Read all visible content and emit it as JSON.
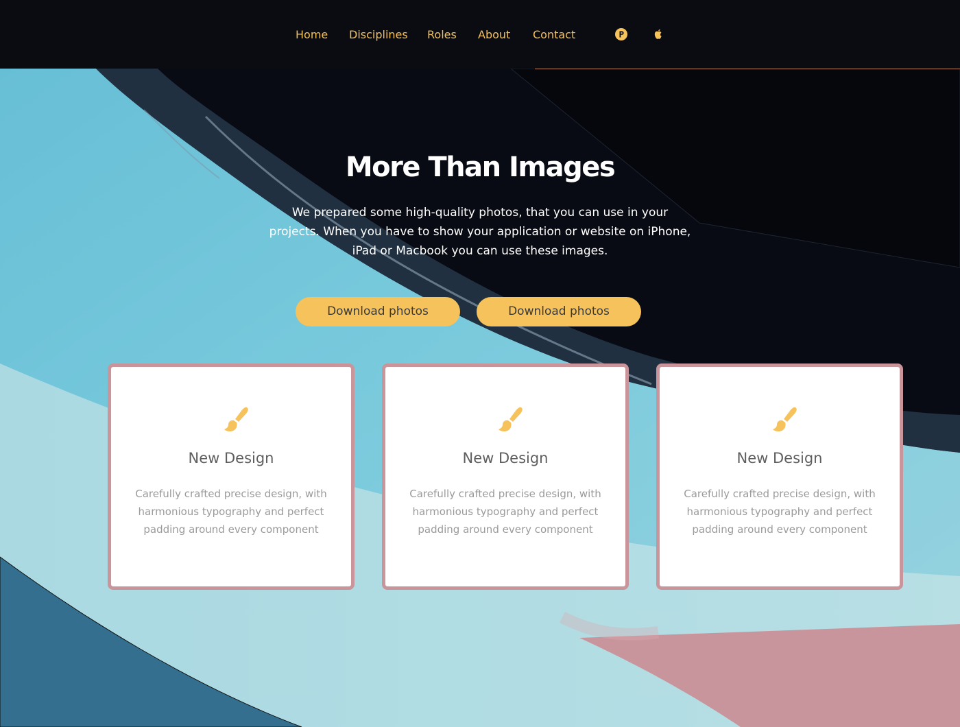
{
  "nav": {
    "links": [
      "Home",
      "Disciplines",
      "Roles",
      "About",
      "Contact"
    ],
    "icons": [
      "producthunt-icon",
      "apple-icon"
    ]
  },
  "hero": {
    "title": "More Than Images",
    "description": "We prepared some high-quality photos, that you can use in your projects. When you have to show your application or website on iPhone, iPad or Macbook you can use these images.",
    "buttons": [
      "Download photos",
      "Download photos"
    ]
  },
  "cards": [
    {
      "icon": "paint-brush-icon",
      "title": "New Design",
      "text": "Carefully crafted precise design, with harmonious typography and perfect padding around every component"
    },
    {
      "icon": "paint-brush-icon",
      "title": "New Design",
      "text": "Carefully crafted precise design, with harmonious typography and perfect padding around every component"
    },
    {
      "icon": "paint-brush-icon",
      "title": "New Design",
      "text": "Carefully crafted precise design, with harmonious typography and perfect padding around every component"
    }
  ],
  "colors": {
    "accent": "#f6c25b",
    "nav_bg": "#0b0c11",
    "card_border": "#c9949a",
    "sky_blue": "#7fcbdc",
    "dark_blue": "#356f8f",
    "pink": "#c9959c"
  }
}
